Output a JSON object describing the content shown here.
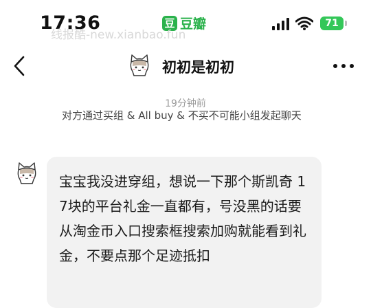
{
  "status_bar": {
    "time": "17:36",
    "app_logo": "豆",
    "app_name": "豆瓣",
    "watermark": "线报酷-new.xianbao.fun",
    "battery": "71",
    "icons": [
      "signal-icon",
      "wifi-icon",
      "battery-icon"
    ]
  },
  "header": {
    "title": "初初是初初",
    "icons": [
      "back-icon",
      "cat-avatar-icon",
      "more-icon"
    ]
  },
  "conversation": {
    "timestamp": "19分钟前",
    "system_notice": "对方通过买组 & All buy & 不买不可能小组发起聊天",
    "messages": [
      {
        "text": "宝宝我没进穿组，想说一下那个斯凯奇 17块的平台礼金一直都有，号没黑的话要从淘金币入口搜索框搜索加购就能看到礼金，不要点那个足迹抵扣"
      }
    ]
  },
  "colors": {
    "brand_green": "#2bb24c",
    "battery_green": "#34c759",
    "bubble_bg": "#f2f2f2"
  }
}
